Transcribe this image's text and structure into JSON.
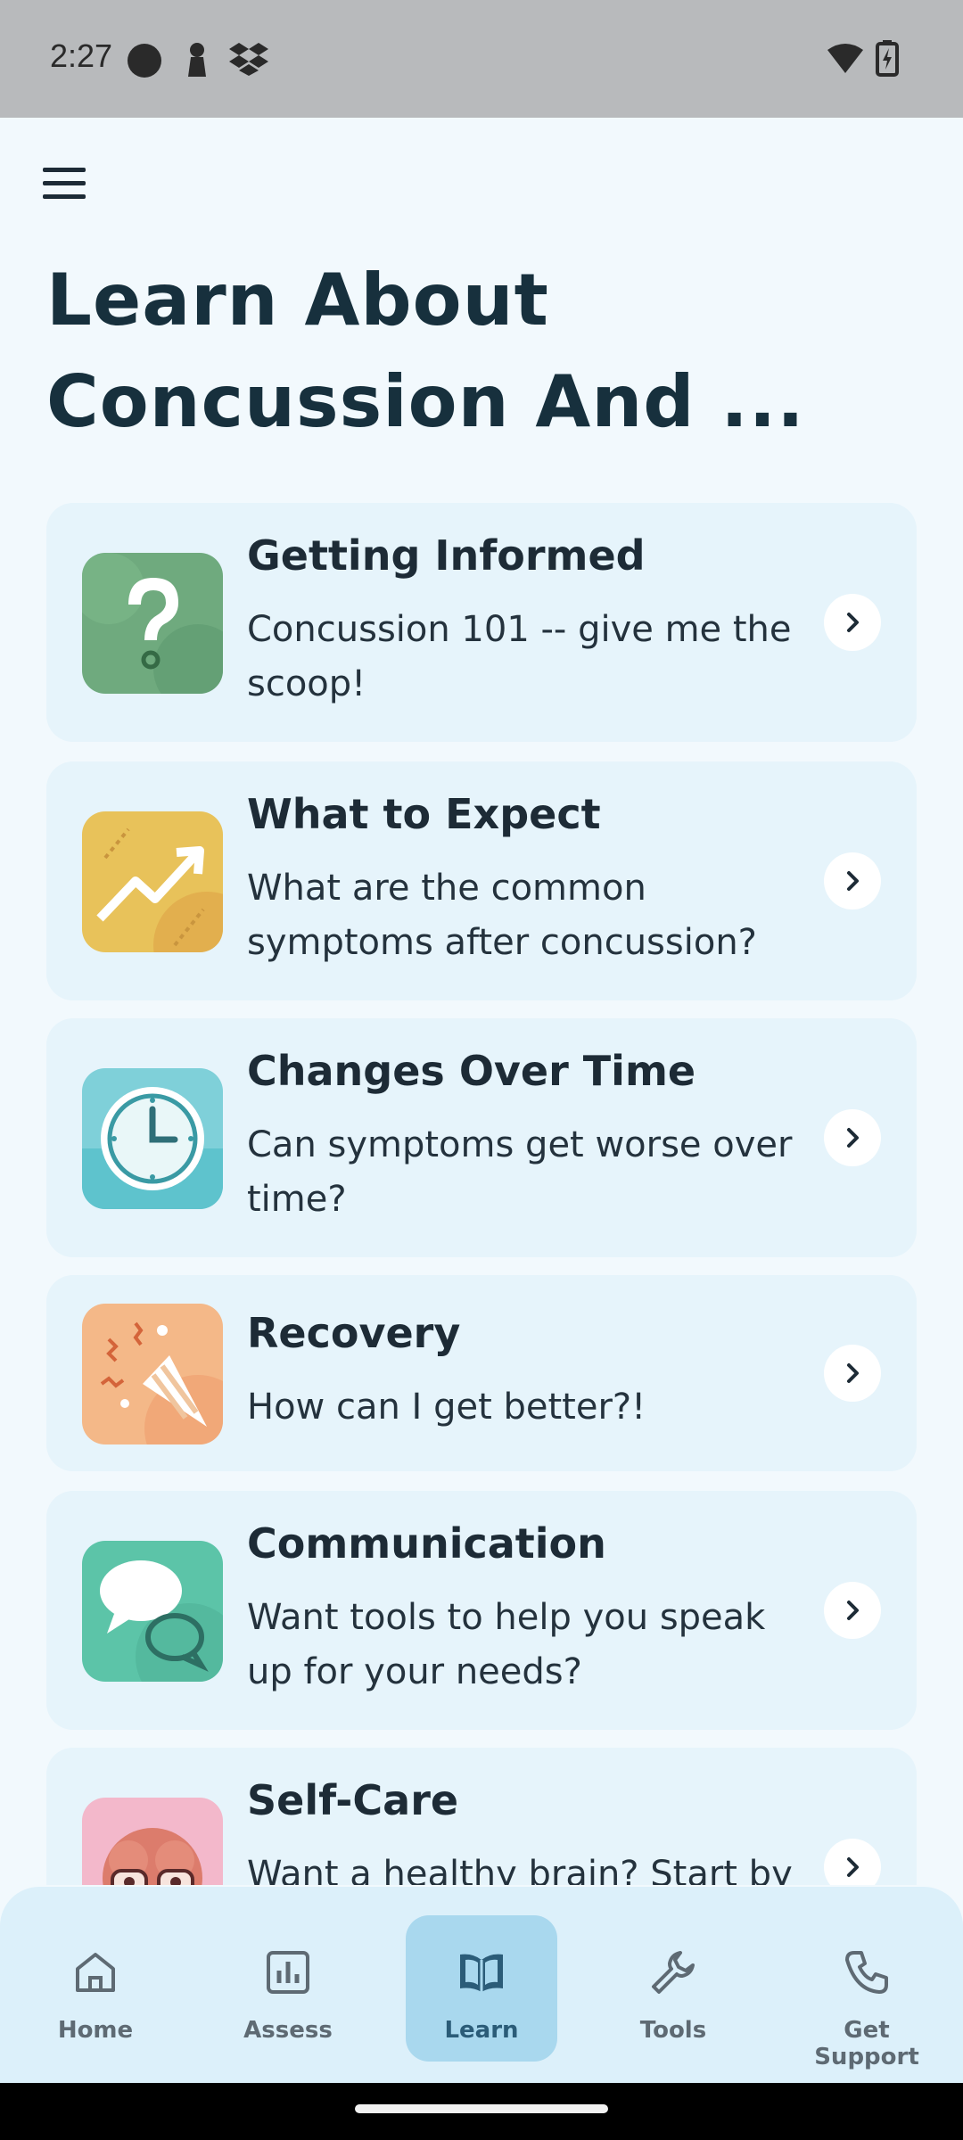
{
  "status_bar": {
    "time": "2:27"
  },
  "page": {
    "title": "Learn About Concussion And ..."
  },
  "topics": [
    {
      "title": "Getting Informed",
      "description": "Concussion 101 -- give me the scoop!",
      "icon": "question-mark-icon",
      "color": "#6faa7e"
    },
    {
      "title": "What to Expect",
      "description": "What are the common symptoms after concussion?",
      "icon": "trend-arrow-icon",
      "color": "#e6c25a"
    },
    {
      "title": "Changes Over Time",
      "description": "Can symptoms get worse over time?",
      "icon": "clock-icon",
      "color": "#6fcad6"
    },
    {
      "title": "Recovery",
      "description": "How can I get better?!",
      "icon": "party-popper-icon",
      "color": "#f2a978"
    },
    {
      "title": "Communication",
      "description": "Want tools to help you speak up for your needs?",
      "icon": "chat-bubbles-icon",
      "color": "#5cc4a8"
    },
    {
      "title": "Self-Care",
      "description": "Want a healthy brain? Start by",
      "icon": "brain-icon",
      "color": "#f0b0c4"
    }
  ],
  "bottom_nav": {
    "active": "Learn",
    "items": [
      {
        "label": "Home",
        "icon": "home-icon"
      },
      {
        "label": "Assess",
        "icon": "bar-chart-icon"
      },
      {
        "label": "Learn",
        "icon": "book-icon"
      },
      {
        "label": "Tools",
        "icon": "wrench-icon"
      },
      {
        "label": "Get Support",
        "icon": "phone-icon"
      }
    ]
  }
}
